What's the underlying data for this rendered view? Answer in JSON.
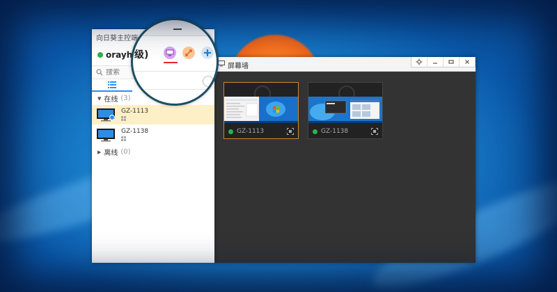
{
  "client": {
    "title": "向日葵主控端",
    "username": "orayhais",
    "search_placeholder": "搜索",
    "groups": [
      {
        "label": "在线",
        "count": "(3)"
      },
      {
        "label": "离线",
        "count": "(0)"
      }
    ],
    "devices": [
      {
        "name": "GZ-1113",
        "selected": true
      },
      {
        "name": "GZ-1138",
        "selected": false
      }
    ]
  },
  "magnifier": {
    "level_text": "级)"
  },
  "wall": {
    "title": "屏幕墙",
    "thumbnails": [
      {
        "name": "GZ-1113",
        "selected": true
      },
      {
        "name": "GZ-1138",
        "selected": false
      }
    ]
  },
  "icons": {
    "remote_desktop": "monitor-icon",
    "remote_control": "control-icon",
    "add": "plus-icon"
  },
  "colors": {
    "online": "#2bb34a",
    "accent_blue": "#2a8ef1",
    "selected_row": "#fdefc6",
    "wall_bg": "#333333"
  }
}
